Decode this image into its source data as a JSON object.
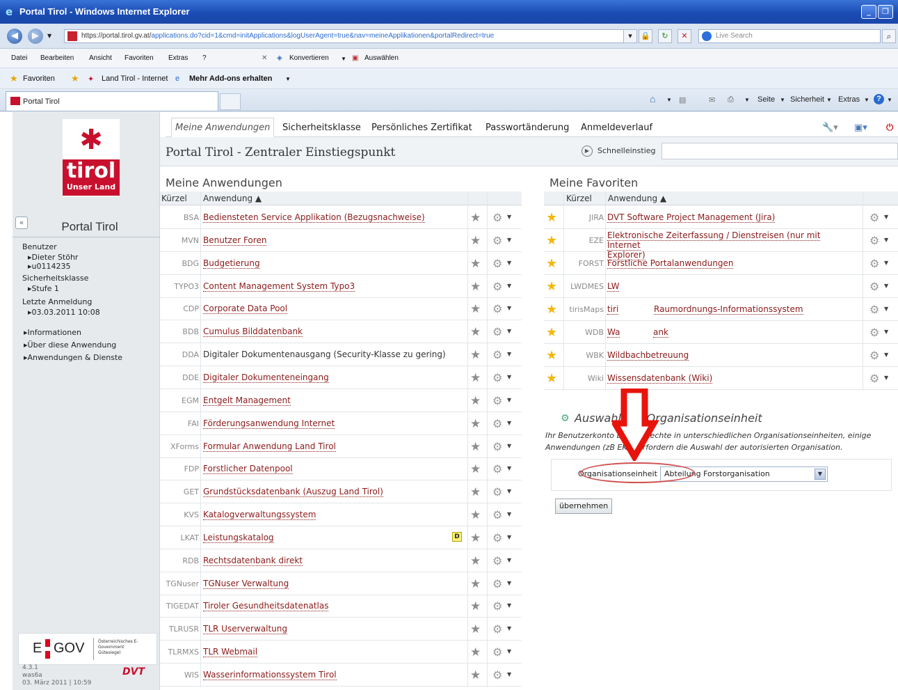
{
  "browser": {
    "window_title": "Portal Tirol - Windows Internet Explorer",
    "url_host": "https://portal.tirol.gv.at/",
    "url_path": "applications.do?cid=1&cmd=initApplications&logUserAgent=true&nav=meineApplikationen&portalRedirect=true",
    "search_placeholder": "Live Search",
    "menu": [
      "Datei",
      "Bearbeiten",
      "Ansicht",
      "Favoriten",
      "Extras",
      "?"
    ],
    "toolbar_convert": "Konvertieren",
    "toolbar_select": "Auswählen",
    "fav_label": "Favoriten",
    "fav_land_tirol": "Land Tirol - Internet",
    "fav_addons": "Mehr Add-ons erhalten",
    "tab_title": "Portal Tirol",
    "cmd_seite": "Seite",
    "cmd_sicherheit": "Sicherheit",
    "cmd_extras": "Extras"
  },
  "logo": {
    "word": "tirol",
    "tagline": "Unser Land"
  },
  "sidebar": {
    "title": "Portal Tirol",
    "collapse_symbol": "«",
    "benutzer_label": "Benutzer",
    "user_name": "Dieter Stöhr",
    "user_id": "u0114235",
    "sicherheitsklasse_label": "Sicherheitsklasse",
    "sicherheitsklasse_value": "Stufe 1",
    "letzte_anmeldung_label": "Letzte Anmeldung",
    "letzte_anmeldung_value": "03.03.2011 10:08",
    "links": [
      "Informationen",
      "Über diese Anwendung",
      "Anwendungen & Dienste"
    ],
    "egov_tag": "Österreichisches E-Government Gütesiegel",
    "version": "4.3.1",
    "server": "was6a",
    "date": "03. März 2011 | 10:59",
    "dvt": "DVT"
  },
  "topnav": [
    "Meine Anwendungen",
    "Sicherheitsklasse",
    "Persönliches Zertifikat",
    "Passwortänderung",
    "Anmeldeverlauf"
  ],
  "page_title": "Portal Tirol - Zentraler Einstiegspunkt",
  "schnelleinstieg_label": "Schnelleinstieg",
  "meine_anwendungen": {
    "title": "Meine Anwendungen",
    "col_kuerzel": "Kürzel",
    "col_anwendung": "Anwendung ▲",
    "rows": [
      {
        "code": "BSA",
        "name": "Bediensteten Service Applikation (Bezugsnachweise)"
      },
      {
        "code": "MVN",
        "name": "Benutzer Foren"
      },
      {
        "code": "BDG",
        "name": "Budgetierung"
      },
      {
        "code": "TYPO3",
        "name": "Content Management System Typo3"
      },
      {
        "code": "CDP",
        "name": "Corporate Data Pool"
      },
      {
        "code": "BDB",
        "name": "Cumulus Bilddatenbank"
      },
      {
        "code": "DDA",
        "name": "Digitaler Dokumentenausgang (Security-Klasse zu gering)"
      },
      {
        "code": "DDE",
        "name": "Digitaler Dokumenteneingang"
      },
      {
        "code": "EGM",
        "name": "Entgelt Management"
      },
      {
        "code": "FAI",
        "name": "Förderungsanwendung Internet"
      },
      {
        "code": "XForms",
        "name": "Formular Anwendung Land Tirol"
      },
      {
        "code": "FDP",
        "name": "Forstlicher Datenpool"
      },
      {
        "code": "GET",
        "name": "Grundstücksdatenbank (Auszug Land Tirol)"
      },
      {
        "code": "KVS",
        "name": "Katalogverwaltungssystem"
      },
      {
        "code": "LKAT",
        "name": "Leistungskatalog"
      },
      {
        "code": "RDB",
        "name": "Rechtsdatenbank direkt"
      },
      {
        "code": "TGNuser",
        "name": "TGNuser Verwaltung"
      },
      {
        "code": "TIGEDAT",
        "name": "Tiroler Gesundheitsdatenatlas"
      },
      {
        "code": "TLRUSR",
        "name": "TLR Userverwaltung"
      },
      {
        "code": "TLRMXS",
        "name": "TLR Webmail"
      },
      {
        "code": "WIS",
        "name": "Wasserinformationssystem Tirol"
      }
    ],
    "lkat_badge": "D"
  },
  "meine_favoriten": {
    "title": "Meine Favoriten",
    "col_kuerzel": "Kürzel",
    "col_anwendung": "Anwendung ▲",
    "rows": [
      {
        "code": "JIRA",
        "name": "DVT Software Project Management (Jira)"
      },
      {
        "code": "EZE",
        "name": "Elektronische Zeiterfassung / Dienstreisen (nur mit Internet",
        "name2": "Explorer)"
      },
      {
        "code": "FORST",
        "name": "Forstliche Portalanwendungen"
      },
      {
        "code": "LWDMES",
        "name": "LW"
      },
      {
        "code": "tirisMaps",
        "name": "tiri",
        "name2": "Raumordnungs-Informationssystem"
      },
      {
        "code": "WDB",
        "name": "Wa",
        "name2": "ank"
      },
      {
        "code": "WBK",
        "name": "Wildbachbetreuung"
      },
      {
        "code": "Wiki",
        "name": "Wissensdatenbank (Wiki)"
      }
    ]
  },
  "org_unit": {
    "heading": "Auswahl der Organisationseinheit",
    "description": "Ihr Benutzerkonto besitzt Rechte in unterschiedlichen Organisationseinheiten, einige Anwendungen (zB EKA) erfordern die Auswahl der autorisierten Organisation.",
    "field_label": "Organisationseinheit",
    "selected": "Abteilung Forstorganisation",
    "submit": "übernehmen"
  },
  "colors": {
    "link": "#8b1a1a",
    "brand_red": "#c8102e",
    "star_gold": "#f1b80c",
    "annotation_red": "#e8140c"
  }
}
